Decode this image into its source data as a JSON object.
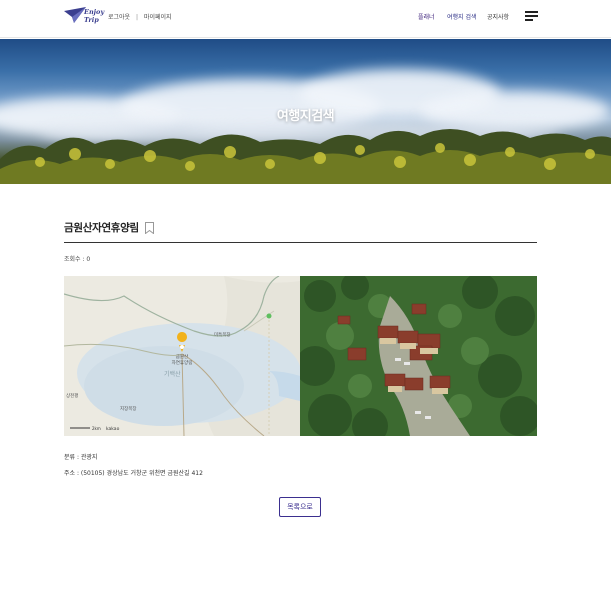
{
  "header": {
    "logo_text": "Enjoy Trip",
    "login_label": "로그아웃",
    "separator": "|",
    "mypage_label": "마이페이지",
    "nav": {
      "planner": "플래너",
      "search": "여행지 검색",
      "notice": "공지사항"
    }
  },
  "banner": {
    "title": "여행지검색"
  },
  "place": {
    "name": "금원산자연휴양림",
    "views": "조회수 : 0",
    "category": "분류 : 관광지",
    "address": "주소 : (50105) 경상남도 거창군 위천면 금원산길 412"
  },
  "map": {
    "marker_label": "금원산\n자연휴양림",
    "scale_label": "2km",
    "provider": "kakao",
    "place_labels": [
      "미특목장",
      "기백산",
      "상천평",
      "지장목장"
    ]
  },
  "actions": {
    "back_label": "목록으로"
  },
  "colors": {
    "brand": "#3b2f8f",
    "nav_active": "#2c2f86",
    "rule": "#333333"
  }
}
